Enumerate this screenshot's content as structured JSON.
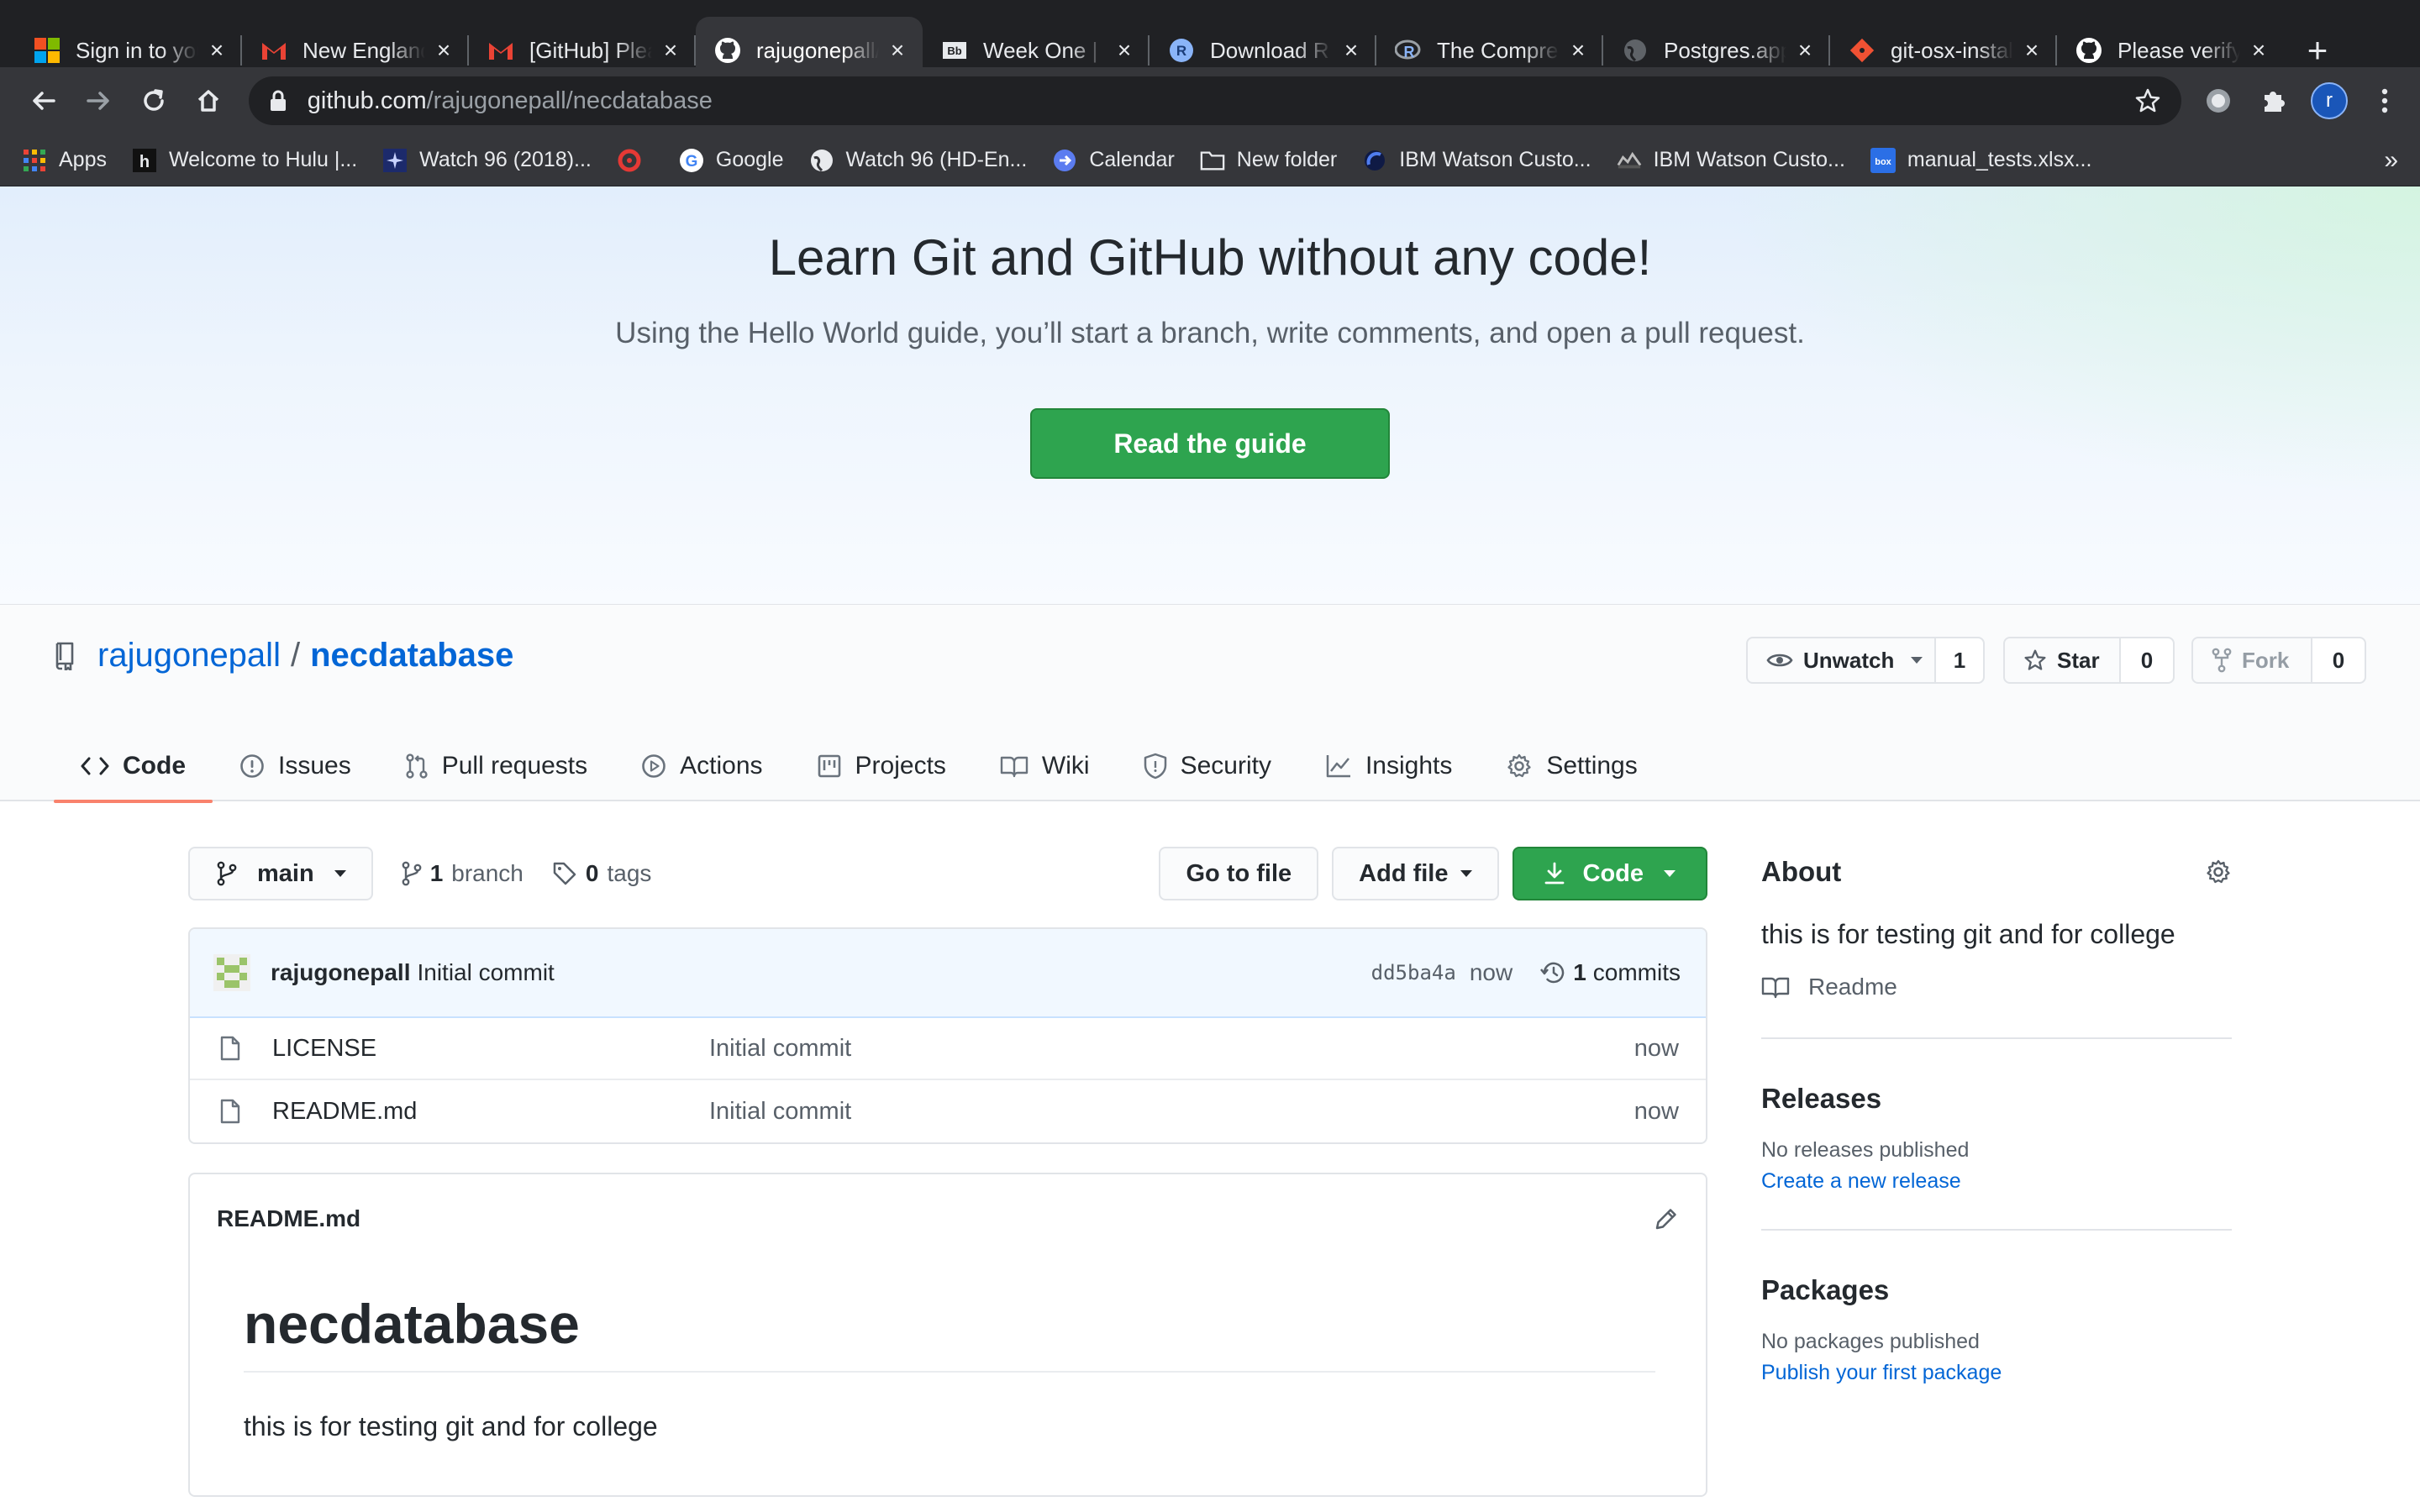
{
  "browser": {
    "tabs": [
      {
        "title": "Sign in to your account",
        "active": false
      },
      {
        "title": "New England",
        "active": false
      },
      {
        "title": "[GitHub] Please verify",
        "active": false
      },
      {
        "title": "rajugonepall/necdatabase",
        "active": true
      },
      {
        "title": "Week One | ",
        "active": false
      },
      {
        "title": "Download R",
        "active": false
      },
      {
        "title": "The Comprehensive",
        "active": false
      },
      {
        "title": "Postgres.app",
        "active": false
      },
      {
        "title": "git-osx-installer",
        "active": false
      },
      {
        "title": "Please verify",
        "active": false
      }
    ],
    "new_tab": "+",
    "url_host": "github.com",
    "url_path": "/rajugonepall/necdatabase",
    "profile_initial": "r",
    "bookmarks": [
      {
        "label": "Apps",
        "icon": "apps-grid-icon"
      },
      {
        "label": "Welcome to Hulu |...",
        "icon": "hulu-icon"
      },
      {
        "label": "Watch 96 (2018)...",
        "icon": "movie-icon"
      },
      {
        "label": "",
        "icon": "red-circle-icon"
      },
      {
        "label": "Google",
        "icon": "google-icon"
      },
      {
        "label": "Watch 96 (HD-En...",
        "icon": "globe-icon"
      },
      {
        "label": "Calendar",
        "icon": "calendar-icon"
      },
      {
        "label": "New folder",
        "icon": "folder-icon"
      },
      {
        "label": "IBM Watson Custo...",
        "icon": "ibm-icon"
      },
      {
        "label": "IBM Watson Custo...",
        "icon": "ibm-icon"
      },
      {
        "label": "manual_tests.xlsx...",
        "icon": "box-icon"
      }
    ],
    "bookmarks_overflow": "»"
  },
  "banner": {
    "title": "Learn Git and GitHub without any code!",
    "subtitle": "Using the Hello World guide, you’ll start a branch, write comments, and open a pull request.",
    "button": "Read the guide"
  },
  "repo": {
    "owner": "rajugonepall",
    "separator": "/",
    "name": "necdatabase",
    "watch_label": "Unwatch",
    "watch_count": "1",
    "star_label": "Star",
    "star_count": "0",
    "fork_label": "Fork",
    "fork_count": "0",
    "nav": [
      {
        "label": "Code",
        "icon": "code-icon",
        "selected": true
      },
      {
        "label": "Issues",
        "icon": "issue-icon"
      },
      {
        "label": "Pull requests",
        "icon": "pull-request-icon"
      },
      {
        "label": "Actions",
        "icon": "play-icon"
      },
      {
        "label": "Projects",
        "icon": "project-icon"
      },
      {
        "label": "Wiki",
        "icon": "book-icon"
      },
      {
        "label": "Security",
        "icon": "shield-icon"
      },
      {
        "label": "Insights",
        "icon": "graph-icon"
      },
      {
        "label": "Settings",
        "icon": "gear-icon"
      }
    ]
  },
  "filenav": {
    "branch": "main",
    "branch_count": "1",
    "branch_word": "branch",
    "tag_count": "0",
    "tag_word": "tags",
    "go_to_file": "Go to file",
    "add_file": "Add file",
    "code": "Code"
  },
  "commit": {
    "author": "rajugonepall",
    "message": "Initial commit",
    "sha": "dd5ba4a",
    "time": "now",
    "count": "1",
    "count_word": "commits"
  },
  "files": [
    {
      "name": "LICENSE",
      "message": "Initial commit",
      "age": "now"
    },
    {
      "name": "README.md",
      "message": "Initial commit",
      "age": "now"
    }
  ],
  "readme": {
    "filename": "README.md",
    "heading": "necdatabase",
    "text": "this is for testing git and for college"
  },
  "about": {
    "title": "About",
    "description": "this is for testing git and for college",
    "readme_link": "Readme",
    "releases_title": "Releases",
    "releases_text": "No releases published",
    "releases_link": "Create a new release",
    "packages_title": "Packages",
    "packages_text": "No packages published",
    "packages_link": "Publish your first package"
  },
  "colors": {
    "primary_green": "#2ea44f",
    "link_blue": "#0366d6",
    "tab_underline": "#f9826c",
    "chrome_dark": "#202124"
  }
}
